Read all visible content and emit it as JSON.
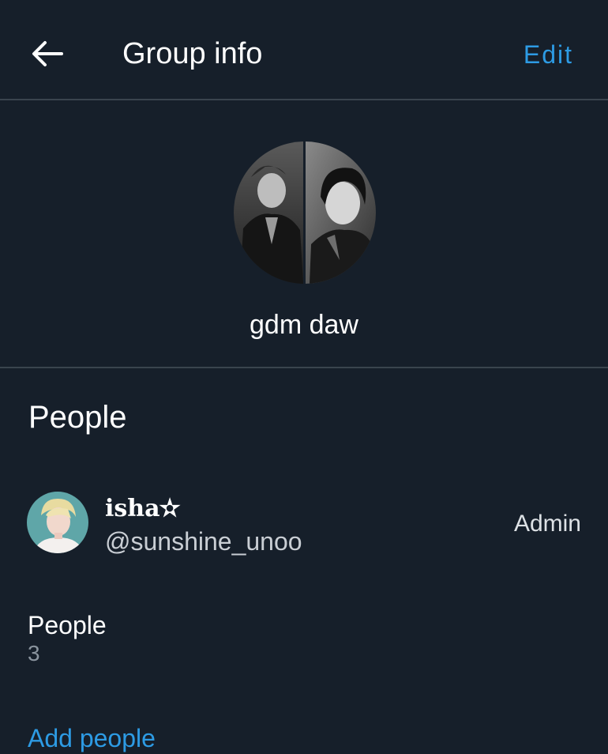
{
  "header": {
    "title": "Group info",
    "edit_label": "Edit",
    "back_icon": "arrow-left-icon"
  },
  "group": {
    "name": "gdm daw"
  },
  "people_section": {
    "title": "People",
    "members": [
      {
        "name": "isha✫",
        "handle": "@sunshine_unoo",
        "role": "Admin"
      }
    ],
    "count_label": "People",
    "count_value": "3",
    "add_label": "Add people"
  },
  "colors": {
    "background": "#161f2a",
    "divider": "#3a444e",
    "accent": "#2d9be4",
    "text_primary": "#ffffff",
    "text_secondary": "#8a949e"
  }
}
